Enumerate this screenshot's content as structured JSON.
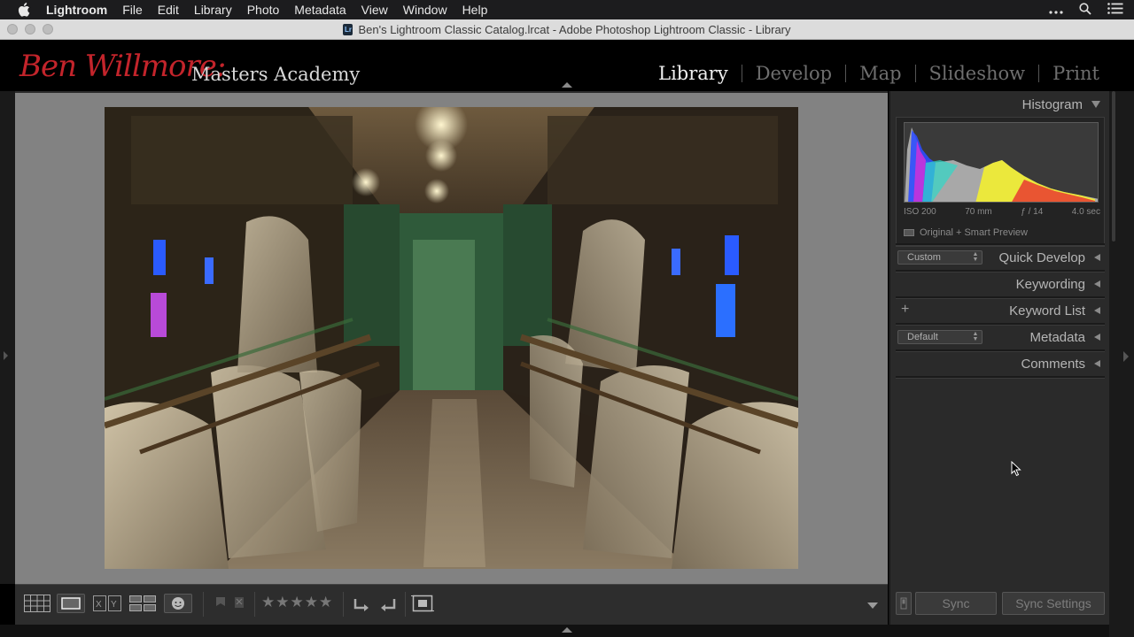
{
  "menubar": {
    "app": "Lightroom",
    "items": [
      "File",
      "Edit",
      "Library",
      "Photo",
      "Metadata",
      "View",
      "Window",
      "Help"
    ],
    "right_icons": [
      "more-icon",
      "search-icon",
      "list-icon"
    ]
  },
  "window": {
    "title": "Ben's Lightroom Classic Catalog.lrcat - Adobe Photoshop Lightroom Classic - Library",
    "doc_icon_text": "Lr"
  },
  "identity": {
    "script_name": "Ben Willmore:",
    "subtitle": "Masters Academy"
  },
  "modules": [
    "Library",
    "Develop",
    "Map",
    "Slideshow",
    "Print"
  ],
  "active_module": "Library",
  "right_panel": {
    "histogram": {
      "title": "Histogram",
      "iso": "ISO 200",
      "focal": "70 mm",
      "aperture": "ƒ / 14",
      "shutter": "4.0 sec",
      "preview_label": "Original + Smart Preview"
    },
    "quick_develop": {
      "title": "Quick Develop",
      "preset": "Custom"
    },
    "keywording": {
      "title": "Keywording"
    },
    "keyword_list": {
      "title": "Keyword List"
    },
    "metadata": {
      "title": "Metadata",
      "preset": "Default"
    },
    "comments": {
      "title": "Comments"
    }
  },
  "sync": {
    "sync_label": "Sync",
    "sync_settings_label": "Sync Settings"
  },
  "toolbar": {
    "view_modes": [
      "grid-view-icon",
      "loupe-view-icon",
      "compare-view-icon",
      "survey-view-icon",
      "people-view-icon"
    ],
    "compare_label": "X|Y",
    "stars": "★★★★★",
    "rating": 0
  },
  "colors": {
    "brand_red": "#c3242b",
    "panel_bg": "#2a2a2a",
    "main_bg": "#828282"
  }
}
